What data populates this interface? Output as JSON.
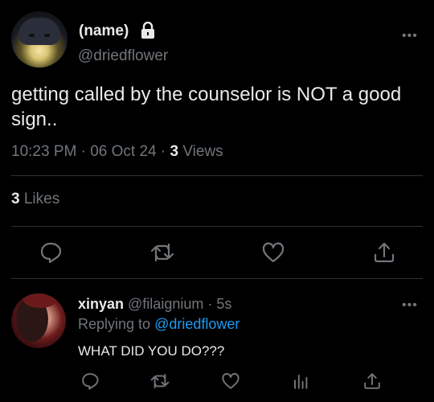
{
  "tweet": {
    "author_name": "(name)",
    "handle": "@driedflower",
    "more_label": "•••",
    "text": "getting called by the counselor is NOT a good sign..",
    "time": "10:23 PM · 06 Oct 24 · ",
    "views_count": "3",
    "views_label": " Views",
    "likes_count": "3",
    "likes_label": " Likes",
    "icons": [
      "reply-icon",
      "retweet-icon",
      "like-icon",
      "share-icon",
      "lock-icon"
    ]
  },
  "reply": {
    "author_name": "xinyan",
    "handle_time": " @filaignium · 5s",
    "replying_prefix": "Replying to ",
    "replying_handle": "@driedflower",
    "text": "WHAT DID YOU DO???",
    "more_label": "•••",
    "icons": [
      "reply-icon",
      "retweet-icon",
      "like-icon",
      "views-icon",
      "share-icon"
    ]
  },
  "colors": {
    "accent": "#1d9bf0",
    "muted": "#71767b",
    "text": "#e7e9ea",
    "background": "#000000",
    "divider": "#2f3336"
  }
}
